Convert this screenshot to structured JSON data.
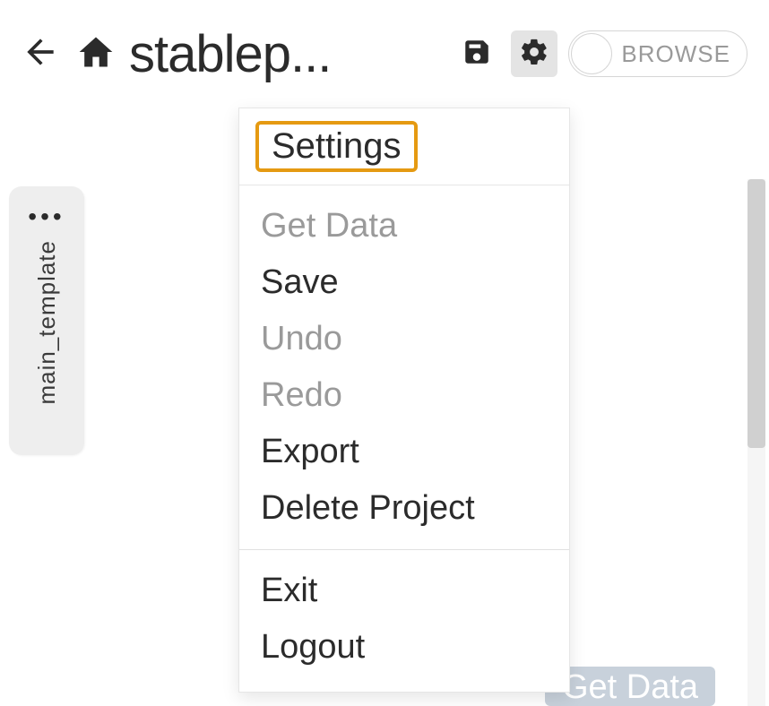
{
  "header": {
    "project_title": "stablep...",
    "browse_label": "BROWSE"
  },
  "sidebar": {
    "tab_label": "main_template"
  },
  "menu": {
    "header_label": "Settings",
    "items": [
      {
        "label": "Get Data",
        "enabled": false
      },
      {
        "label": "Save",
        "enabled": true
      },
      {
        "label": "Undo",
        "enabled": false
      },
      {
        "label": "Redo",
        "enabled": false
      },
      {
        "label": "Export",
        "enabled": true
      },
      {
        "label": "Delete Project",
        "enabled": true
      }
    ],
    "footer_items": [
      {
        "label": "Exit",
        "enabled": true
      },
      {
        "label": "Logout",
        "enabled": true
      }
    ]
  },
  "background_button_label": "Get Data"
}
